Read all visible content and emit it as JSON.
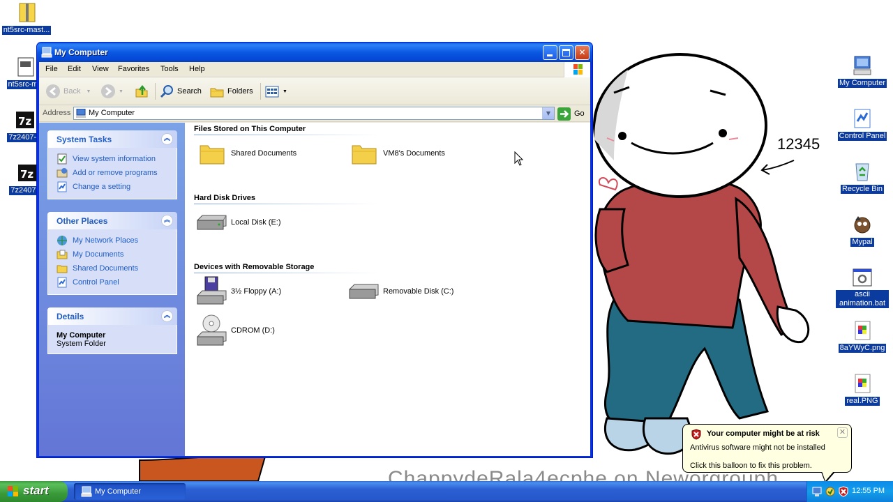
{
  "desktop": {
    "icons_left": [
      {
        "label": "nt5src-mast..."
      },
      {
        "label": "nt5src-ma"
      },
      {
        "label": "7z2407-x"
      },
      {
        "label": "7z2407.e"
      }
    ],
    "icons_right": [
      {
        "label": "My Computer"
      },
      {
        "label": "Control Panel"
      },
      {
        "label": "Recycle Bin"
      },
      {
        "label": "Mypal"
      },
      {
        "label": "ascii animation.bat"
      },
      {
        "label": "8aYWyC.png"
      },
      {
        "label": "real.PNG"
      }
    ],
    "wallpaper_text": "12345",
    "watermark": "ChappydeRala4ecphe on Neworgrouph"
  },
  "window": {
    "title": "My Computer",
    "menu": [
      "File",
      "Edit",
      "View",
      "Favorites",
      "Tools",
      "Help"
    ],
    "toolbar": {
      "back": "Back",
      "search": "Search",
      "folders": "Folders"
    },
    "address": {
      "label": "Address",
      "value": "My Computer",
      "go": "Go"
    },
    "left_panels": [
      {
        "title": "System Tasks",
        "links": [
          "View system information",
          "Add or remove programs",
          "Change a setting"
        ]
      },
      {
        "title": "Other Places",
        "links": [
          "My Network Places",
          "My Documents",
          "Shared Documents",
          "Control Panel"
        ]
      },
      {
        "title": "Details",
        "detail_name": "My Computer",
        "detail_type": "System Folder"
      }
    ],
    "groups": [
      {
        "title": "Files Stored on This Computer",
        "items": [
          "Shared Documents",
          "VM8's Documents"
        ]
      },
      {
        "title": "Hard Disk Drives",
        "items": [
          "Local Disk (E:)"
        ]
      },
      {
        "title": "Devices with Removable Storage",
        "items": [
          "3½ Floppy (A:)",
          "Removable Disk (C:)",
          "CDROM (D:)"
        ]
      }
    ]
  },
  "balloon": {
    "title": "Your computer might be at risk",
    "line1": "Antivirus software might not be installed",
    "line2": "Click this balloon to fix this problem."
  },
  "taskbar": {
    "start": "start",
    "task_button": "My Computer",
    "clock": "12:55 PM"
  },
  "colors": {
    "xp_blue": "#0831d9",
    "task_link": "#215dc6",
    "start_green": "#3c9c3c"
  }
}
